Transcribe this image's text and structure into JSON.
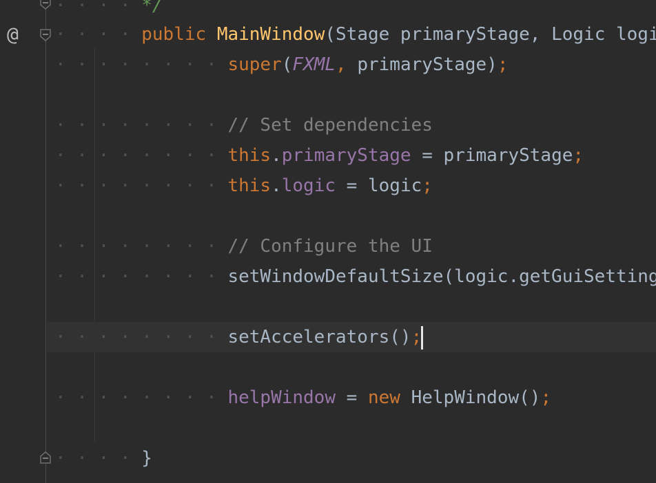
{
  "editor": {
    "lines": [
      {
        "id": "doc-end",
        "text": "*/"
      },
      {
        "id": "ctor",
        "kw": "public",
        "name": "MainWindow",
        "params": "(Stage primaryStage, Logic logic) {"
      },
      {
        "id": "super",
        "call": "super",
        "open": "(",
        "const": "FXML",
        "comma": ",",
        "arg": " primaryStage",
        "close": ")",
        "semi": ";"
      },
      {
        "id": "comment1",
        "text": "// Set dependencies"
      },
      {
        "id": "assign1",
        "this": "this",
        "dot": ".",
        "field": "primaryStage",
        "eq": " = ",
        "value": "primaryStage",
        "semi": ";"
      },
      {
        "id": "assign2",
        "this": "this",
        "dot": ".",
        "field": "logic",
        "eq": " = ",
        "value": "logic",
        "semi": ";"
      },
      {
        "id": "comment2",
        "text": "// Configure the UI"
      },
      {
        "id": "call1",
        "text": "setWindowDefaultSize(logic.getGuiSettings())",
        "semi": ";"
      },
      {
        "id": "call2",
        "text": "setAccelerators()",
        "semi": ";"
      },
      {
        "id": "assign3",
        "field": "helpWindow",
        "eq": " = ",
        "kw": "new",
        "value": " HelpWindow()",
        "semi": ";"
      },
      {
        "id": "close",
        "text": "}"
      }
    ],
    "gutter": {
      "annotation_icon": "@",
      "icons": [
        "fold-marker-icon",
        "override-annotation-icon"
      ]
    }
  },
  "colors": {
    "background": "#2b2b2b",
    "keyword": "#cc7832",
    "function": "#ffc66d",
    "field": "#9876aa",
    "comment": "#808080",
    "text": "#a9b7c6",
    "doc": "#629755"
  }
}
